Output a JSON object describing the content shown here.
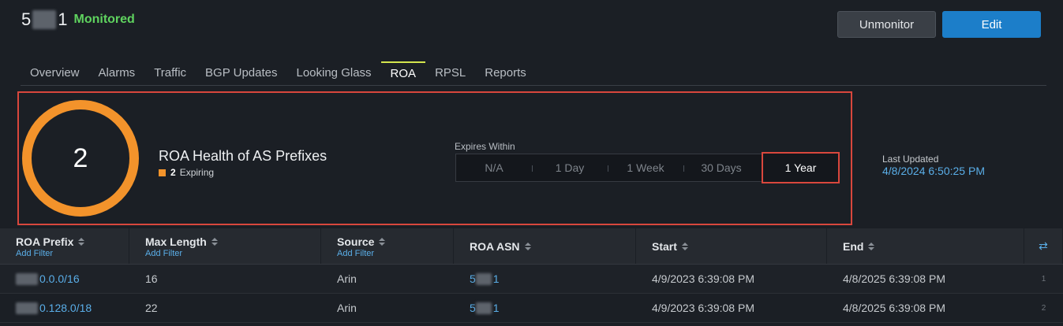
{
  "header": {
    "as_prefix": "5",
    "as_suffix": "1",
    "status": "Monitored",
    "unmonitor_label": "Unmonitor",
    "edit_label": "Edit"
  },
  "tabs": [
    {
      "label": "Overview"
    },
    {
      "label": "Alarms"
    },
    {
      "label": "Traffic"
    },
    {
      "label": "BGP Updates"
    },
    {
      "label": "Looking Glass"
    },
    {
      "label": "ROA",
      "active": true
    },
    {
      "label": "RPSL"
    },
    {
      "label": "Reports"
    }
  ],
  "summary": {
    "count": "2",
    "title": "ROA Health of AS Prefixes",
    "legend_count": "2",
    "legend_label": "Expiring",
    "legend_color": "#f3932b",
    "expires_label": "Expires Within",
    "expires_options": [
      "N/A",
      "1 Day",
      "1 Week",
      "30 Days",
      "1 Year"
    ],
    "expires_selected": "1 Year",
    "last_updated_label": "Last Updated",
    "last_updated_value": "4/8/2024 6:50:25 PM"
  },
  "table": {
    "add_filter": "Add Filter",
    "columns": [
      "ROA Prefix",
      "Max Length",
      "Source",
      "ROA ASN",
      "Start",
      "End"
    ],
    "rows": [
      {
        "prefix": "0.0.0/16",
        "max_length": "16",
        "source": "Arin",
        "asn_prefix": "5",
        "asn_suffix": "1",
        "start": "4/9/2023 6:39:08 PM",
        "end": "4/8/2025 6:39:08 PM",
        "num": "1"
      },
      {
        "prefix": "0.128.0/18",
        "max_length": "22",
        "source": "Arin",
        "asn_prefix": "5",
        "asn_suffix": "1",
        "start": "4/9/2023 6:39:08 PM",
        "end": "4/8/2025 6:39:08 PM",
        "num": "2"
      }
    ]
  },
  "colors": {
    "accent": "#1c7ec9",
    "monitored": "#5fd35f",
    "highlight": "#d9473d",
    "link": "#5aaee8"
  }
}
